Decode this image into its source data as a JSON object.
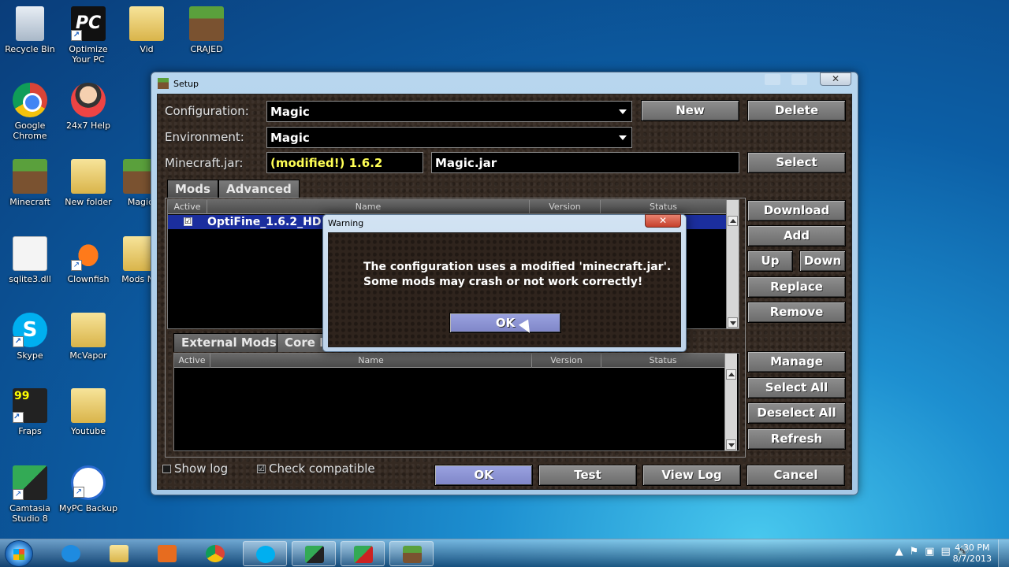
{
  "desktop": {
    "icons": [
      {
        "label": "Recycle Bin"
      },
      {
        "label": "Optimize Your PC"
      },
      {
        "label": "Vid"
      },
      {
        "label": "CRAJED"
      },
      {
        "label": "Google Chrome"
      },
      {
        "label": "24x7 Help"
      },
      {
        "label": "Minecraft"
      },
      {
        "label": "New folder"
      },
      {
        "label": "Magic"
      },
      {
        "label": "sqlite3.dll"
      },
      {
        "label": "Clownfish"
      },
      {
        "label": "Mods Ne"
      },
      {
        "label": "Skype"
      },
      {
        "label": "McVapor"
      },
      {
        "label": "Fraps"
      },
      {
        "label": "Youtube"
      },
      {
        "label": "Camtasia Studio 8"
      },
      {
        "label": "MyPC Backup"
      }
    ],
    "glyphs": {
      "pc": "PC",
      "skype": "S",
      "fraps": "99"
    }
  },
  "window": {
    "title": "Setup",
    "close_glyph": "✕",
    "configuration_label": "Configuration:",
    "configuration_value": "Magic",
    "environment_label": "Environment:",
    "environment_value": "Magic",
    "jar_label": "Minecraft.jar:",
    "jar_version": "(modified!) 1.6.2",
    "jar_file": "Magic.jar",
    "buttons": {
      "new": "New",
      "delete": "Delete",
      "select": "Select",
      "download": "Download",
      "add": "Add",
      "up": "Up",
      "down": "Down",
      "replace": "Replace",
      "remove": "Remove",
      "manage": "Manage",
      "select_all": "Select All",
      "deselect_all": "Deselect All",
      "refresh": "Refresh",
      "ok": "OK",
      "test": "Test",
      "view_log": "View Log",
      "cancel": "Cancel"
    },
    "tabs": {
      "mods": "Mods",
      "advanced": "Advanced",
      "external_mods": "External Mods",
      "core_mods": "Core M"
    },
    "columns": {
      "active": "Active",
      "name": "Name",
      "version": "Version",
      "status": "Status"
    },
    "mods_rows": [
      {
        "active": true,
        "name": "OptiFine_1.6.2_HD"
      }
    ],
    "check_glyph": "☑",
    "show_log": {
      "label": "Show log",
      "checked": false
    },
    "check_compatible": {
      "label": "Check compatible",
      "checked": true
    }
  },
  "warning": {
    "title": "Warning",
    "close_glyph": "✕",
    "line1": "The configuration uses a modified 'minecraft.jar'.",
    "line2": "Some mods may crash or not work correctly!",
    "ok": "OK"
  },
  "taskbar": {
    "time": "4:30 PM",
    "date": "8/7/2013",
    "tray_glyphs": [
      "▲",
      "⚑",
      "▣",
      "▤",
      "🔊"
    ]
  },
  "colors": {
    "mc_button": "#7a7a7a",
    "mc_button_highlight": "#8f95d6",
    "warning_yellow": "#ffff55",
    "selection_blue": "#1b2e9e"
  }
}
